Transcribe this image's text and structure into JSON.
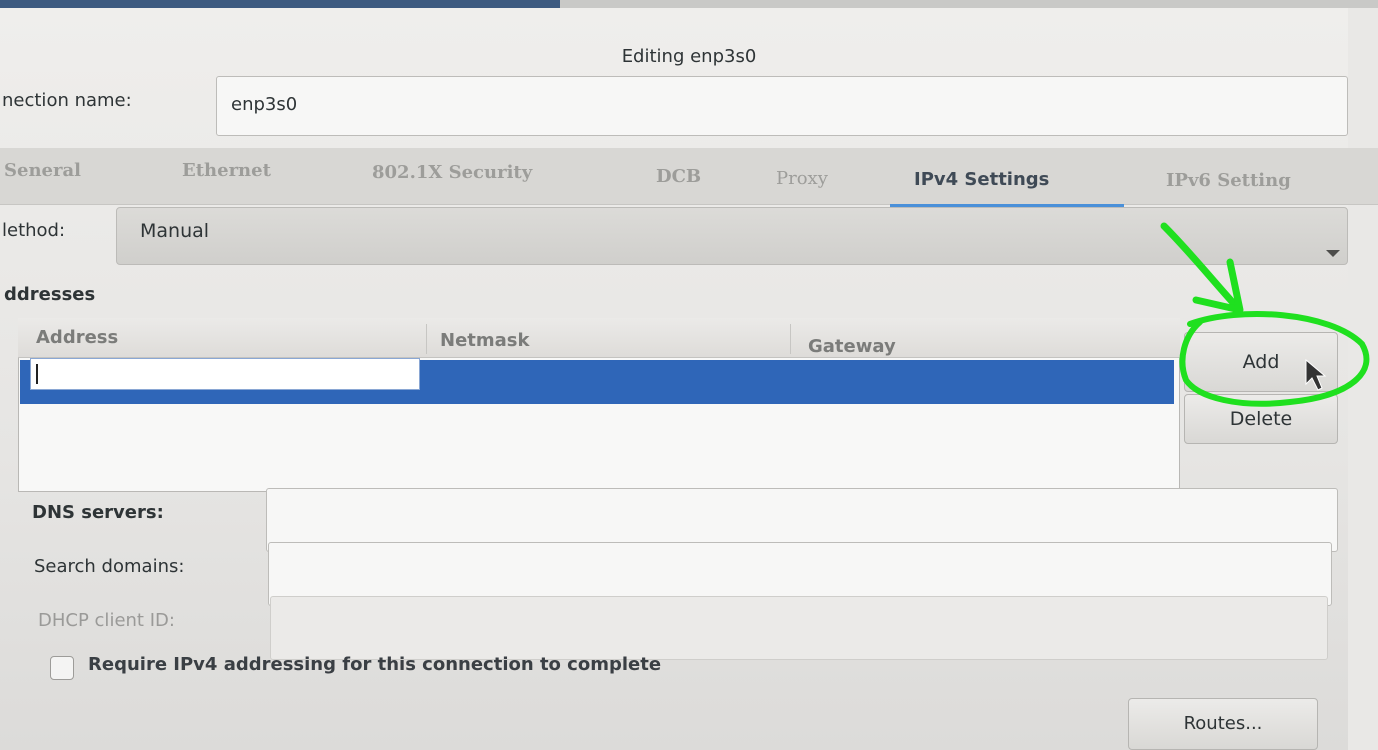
{
  "window": {
    "title": "Editing enp3s0"
  },
  "connection": {
    "label": "nection name:",
    "value": "enp3s0"
  },
  "tabs": [
    {
      "label": "Seneral"
    },
    {
      "label": "Ethernet"
    },
    {
      "label": "802.1X Security"
    },
    {
      "label": "DCB"
    },
    {
      "label": "Proxy"
    },
    {
      "label": "IPv4 Settings"
    },
    {
      "label": "IPv6 Setting"
    }
  ],
  "method": {
    "label": "lethod:",
    "value": "Manual"
  },
  "addresses": {
    "heading": "ddresses",
    "columns": [
      "Address",
      "Netmask",
      "Gateway"
    ],
    "add_label": "Add",
    "delete_label": "Delete"
  },
  "fields": {
    "dns_label": "DNS servers:",
    "search_label": "Search domains:",
    "dhcp_label": "DHCP client ID:"
  },
  "require": {
    "label": "Require IPv4 addressing for this connection to complete"
  },
  "routes": {
    "label": "Routes..."
  },
  "colors": {
    "selection": "#2f66b8",
    "annotation": "#1fe01f",
    "tab_underline": "#4a90d9"
  }
}
